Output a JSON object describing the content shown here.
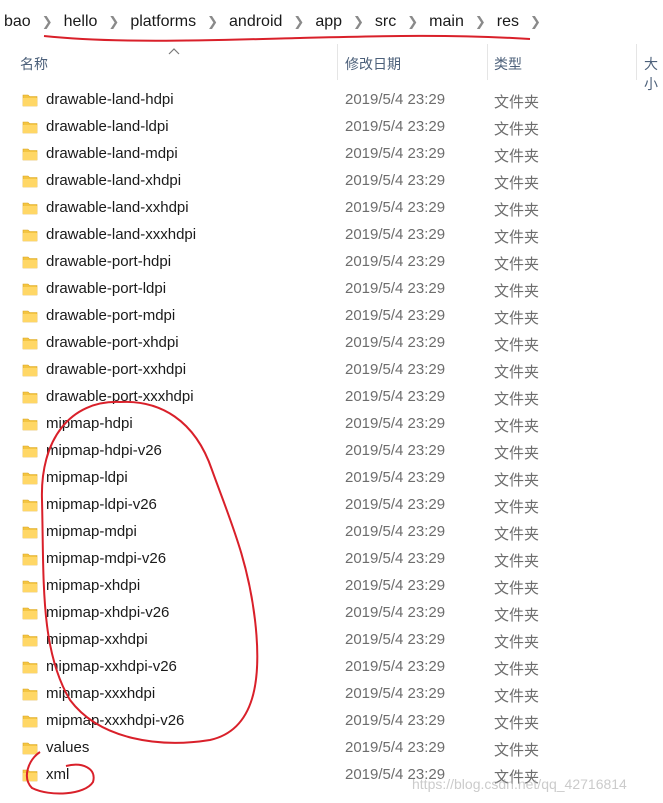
{
  "breadcrumb": {
    "items": [
      "bao",
      "hello",
      "platforms",
      "android",
      "app",
      "src",
      "main",
      "res"
    ]
  },
  "columns": {
    "name": "名称",
    "modified": "修改日期",
    "type": "类型",
    "size": "大小"
  },
  "files": [
    {
      "name": "drawable-land-hdpi",
      "date": "2019/5/4 23:29",
      "type": "文件夹"
    },
    {
      "name": "drawable-land-ldpi",
      "date": "2019/5/4 23:29",
      "type": "文件夹"
    },
    {
      "name": "drawable-land-mdpi",
      "date": "2019/5/4 23:29",
      "type": "文件夹"
    },
    {
      "name": "drawable-land-xhdpi",
      "date": "2019/5/4 23:29",
      "type": "文件夹"
    },
    {
      "name": "drawable-land-xxhdpi",
      "date": "2019/5/4 23:29",
      "type": "文件夹"
    },
    {
      "name": "drawable-land-xxxhdpi",
      "date": "2019/5/4 23:29",
      "type": "文件夹"
    },
    {
      "name": "drawable-port-hdpi",
      "date": "2019/5/4 23:29",
      "type": "文件夹"
    },
    {
      "name": "drawable-port-ldpi",
      "date": "2019/5/4 23:29",
      "type": "文件夹"
    },
    {
      "name": "drawable-port-mdpi",
      "date": "2019/5/4 23:29",
      "type": "文件夹"
    },
    {
      "name": "drawable-port-xhdpi",
      "date": "2019/5/4 23:29",
      "type": "文件夹"
    },
    {
      "name": "drawable-port-xxhdpi",
      "date": "2019/5/4 23:29",
      "type": "文件夹"
    },
    {
      "name": "drawable-port-xxxhdpi",
      "date": "2019/5/4 23:29",
      "type": "文件夹"
    },
    {
      "name": "mipmap-hdpi",
      "date": "2019/5/4 23:29",
      "type": "文件夹"
    },
    {
      "name": "mipmap-hdpi-v26",
      "date": "2019/5/4 23:29",
      "type": "文件夹"
    },
    {
      "name": "mipmap-ldpi",
      "date": "2019/5/4 23:29",
      "type": "文件夹"
    },
    {
      "name": "mipmap-ldpi-v26",
      "date": "2019/5/4 23:29",
      "type": "文件夹"
    },
    {
      "name": "mipmap-mdpi",
      "date": "2019/5/4 23:29",
      "type": "文件夹"
    },
    {
      "name": "mipmap-mdpi-v26",
      "date": "2019/5/4 23:29",
      "type": "文件夹"
    },
    {
      "name": "mipmap-xhdpi",
      "date": "2019/5/4 23:29",
      "type": "文件夹"
    },
    {
      "name": "mipmap-xhdpi-v26",
      "date": "2019/5/4 23:29",
      "type": "文件夹"
    },
    {
      "name": "mipmap-xxhdpi",
      "date": "2019/5/4 23:29",
      "type": "文件夹"
    },
    {
      "name": "mipmap-xxhdpi-v26",
      "date": "2019/5/4 23:29",
      "type": "文件夹"
    },
    {
      "name": "mipmap-xxxhdpi",
      "date": "2019/5/4 23:29",
      "type": "文件夹"
    },
    {
      "name": "mipmap-xxxhdpi-v26",
      "date": "2019/5/4 23:29",
      "type": "文件夹"
    },
    {
      "name": "values",
      "date": "2019/5/4 23:29",
      "type": "文件夹"
    },
    {
      "name": "xml",
      "date": "2019/5/4 23:29",
      "type": "文件夹"
    }
  ],
  "watermark": "https://blog.csdn.net/qq_42716814",
  "colors": {
    "folder": "#f4c542",
    "annotation": "#d9202a",
    "header_text": "#4c607a"
  }
}
